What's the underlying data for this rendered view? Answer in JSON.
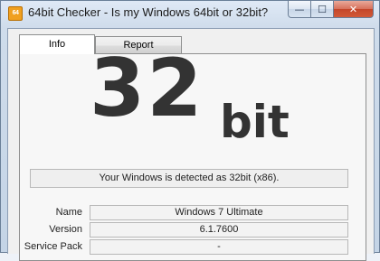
{
  "window": {
    "title": "64bit Checker - Is my Windows 64bit or 32bit?",
    "app_icon_text": "64",
    "app_icon_name": "app-logo-icon",
    "caption_buttons": {
      "minimize": "—",
      "maximize": "☐",
      "close": "✕"
    }
  },
  "tabs": [
    {
      "label": "Info",
      "selected": true
    },
    {
      "label": "Report",
      "selected": false
    }
  ],
  "result": {
    "number": "32",
    "unit": "bit",
    "message": "Your Windows is detected as 32bit (x86)."
  },
  "details": [
    {
      "label": "Name",
      "value": "Windows 7 Ultimate"
    },
    {
      "label": "Version",
      "value": "6.1.7600"
    },
    {
      "label": "Service Pack",
      "value": "-"
    }
  ],
  "colors": {
    "close_button": "#c4462a",
    "result_text": "#333333",
    "title_bar": "#cfdceb"
  }
}
